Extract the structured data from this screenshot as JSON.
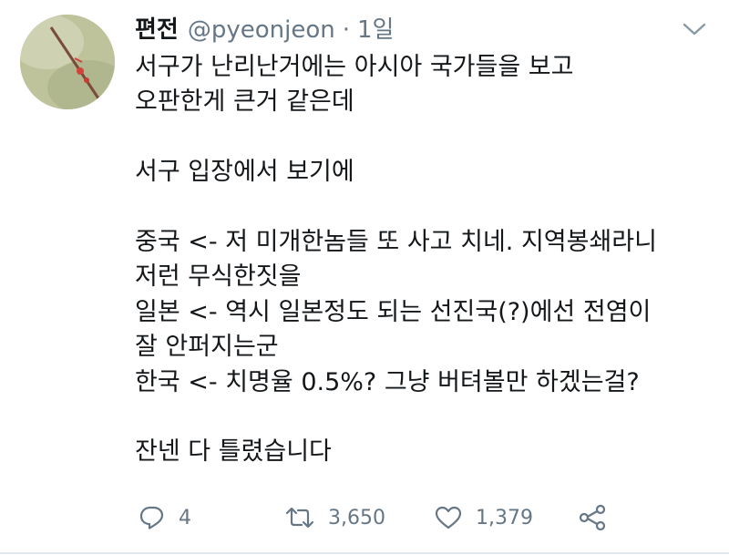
{
  "tweet": {
    "display_name": "편전",
    "handle": "@pyeonjeon",
    "separator": "·",
    "time": "1일",
    "text_lines": [
      "서구가 난리난거에는 아시아 국가들을 보고",
      "오판한게 큰거 같은데",
      "",
      "서구 입장에서 보기에",
      "",
      "중국 <- 저 미개한놈들 또 사고 치네. 지역봉쇄라니",
      "저런 무식한짓을",
      "일본 <- 역시 일본정도 되는 선진국(?)에선 전염이",
      "잘 안퍼지는군",
      "한국 <- 치명율 0.5%? 그냥 버텨볼만 하겠는걸?",
      "",
      "잔넨 다 틀렸습니다"
    ],
    "actions": {
      "reply_count": "4",
      "retweet_count": "3,650",
      "like_count": "1,379"
    }
  },
  "icons": {
    "menu": "chevron-down-icon",
    "reply": "reply-icon",
    "retweet": "retweet-icon",
    "like": "heart-icon",
    "share": "share-icon"
  },
  "colors": {
    "text_primary": "#14171a",
    "text_secondary": "#657786",
    "divider": "#e1e8ed"
  }
}
